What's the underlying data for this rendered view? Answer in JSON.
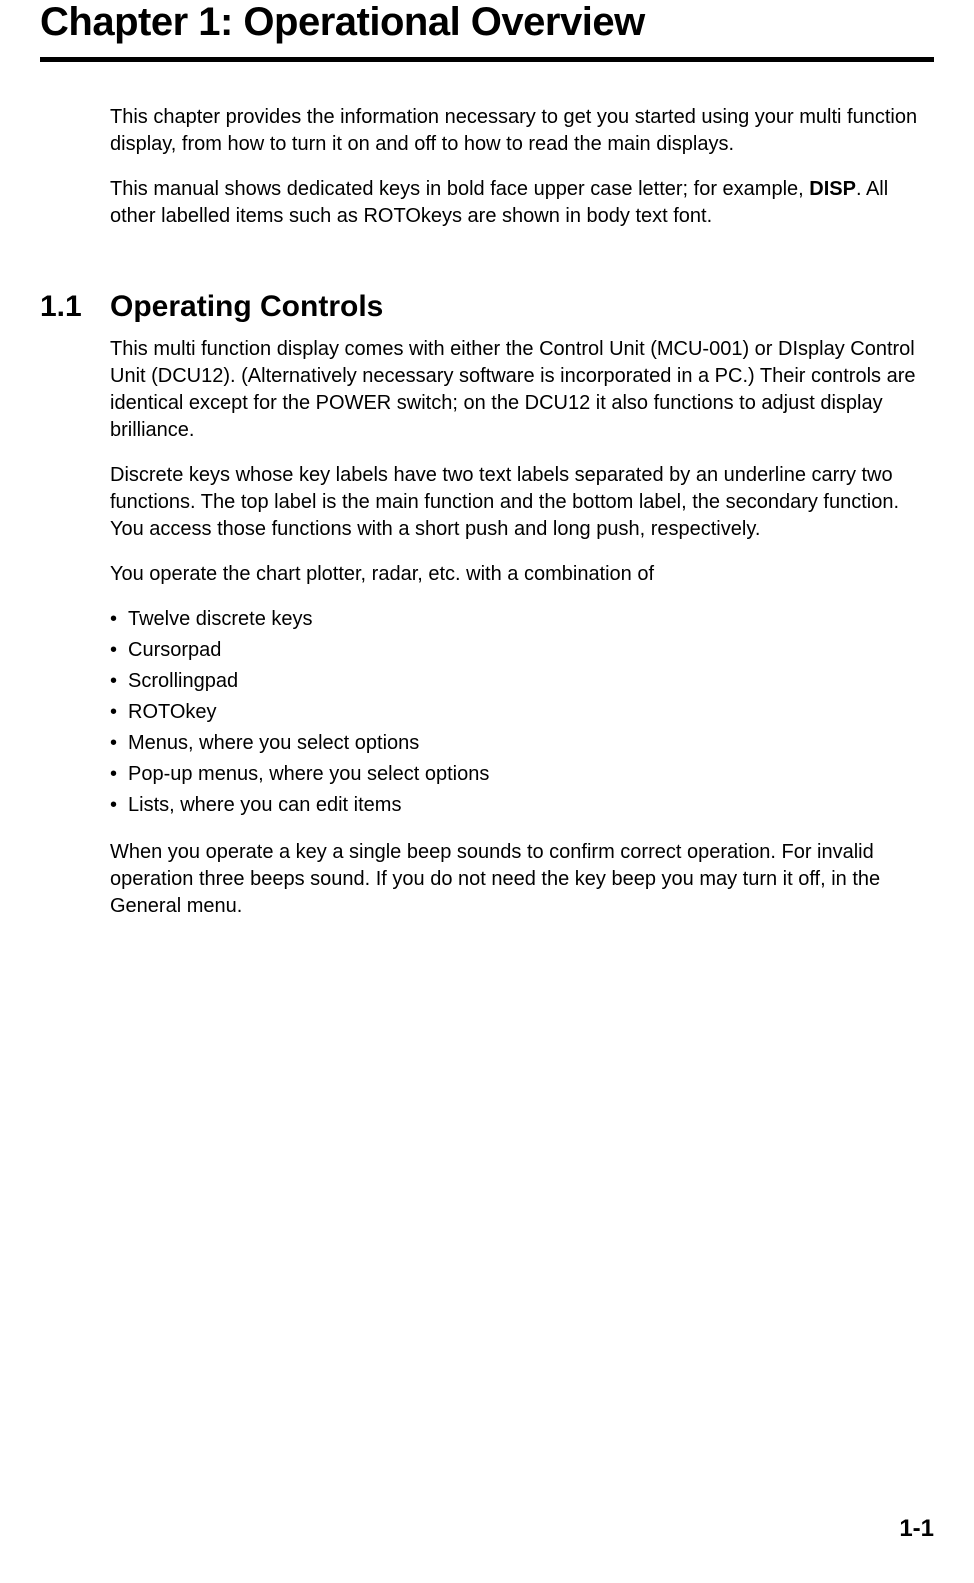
{
  "chapter": {
    "title": "Chapter 1: Operational Overview"
  },
  "intro": {
    "p1": "This chapter provides the information necessary to get you started using your multi function display, from how to turn it on and off to how to read the main displays.",
    "p2_a": "This manual shows dedicated keys in bold face upper case letter; for example, ",
    "p2_key": "DISP",
    "p2_b": ". All other labelled items such as ROTOkeys are shown in body text font."
  },
  "section": {
    "number": "1.1",
    "title": "Operating Controls",
    "p1": "This multi function display comes with either the Control Unit (MCU-001) or DIsplay Control Unit (DCU12). (Alternatively necessary software is incorporated in a PC.) Their controls are identical except for the POWER switch; on the DCU12 it also functions to adjust display brilliance.",
    "p2": "Discrete keys whose key labels have two text labels separated by an underline carry two functions. The top label is the main function and the bottom label, the secondary function. You access those functions with a short push and long push, respectively.",
    "p3": "You operate the chart plotter, radar, etc. with a combination of",
    "bullets": [
      "Twelve discrete keys",
      "Cursorpad",
      "Scrollingpad",
      "ROTOkey",
      "Menus, where you select options",
      "Pop-up menus, where you select options",
      "Lists, where you can edit items"
    ],
    "p4": "When you operate a key a single beep sounds to confirm correct operation. For invalid operation three beeps sound. If you do not need the key beep you may turn it off, in the General menu."
  },
  "page_number": "1-1"
}
